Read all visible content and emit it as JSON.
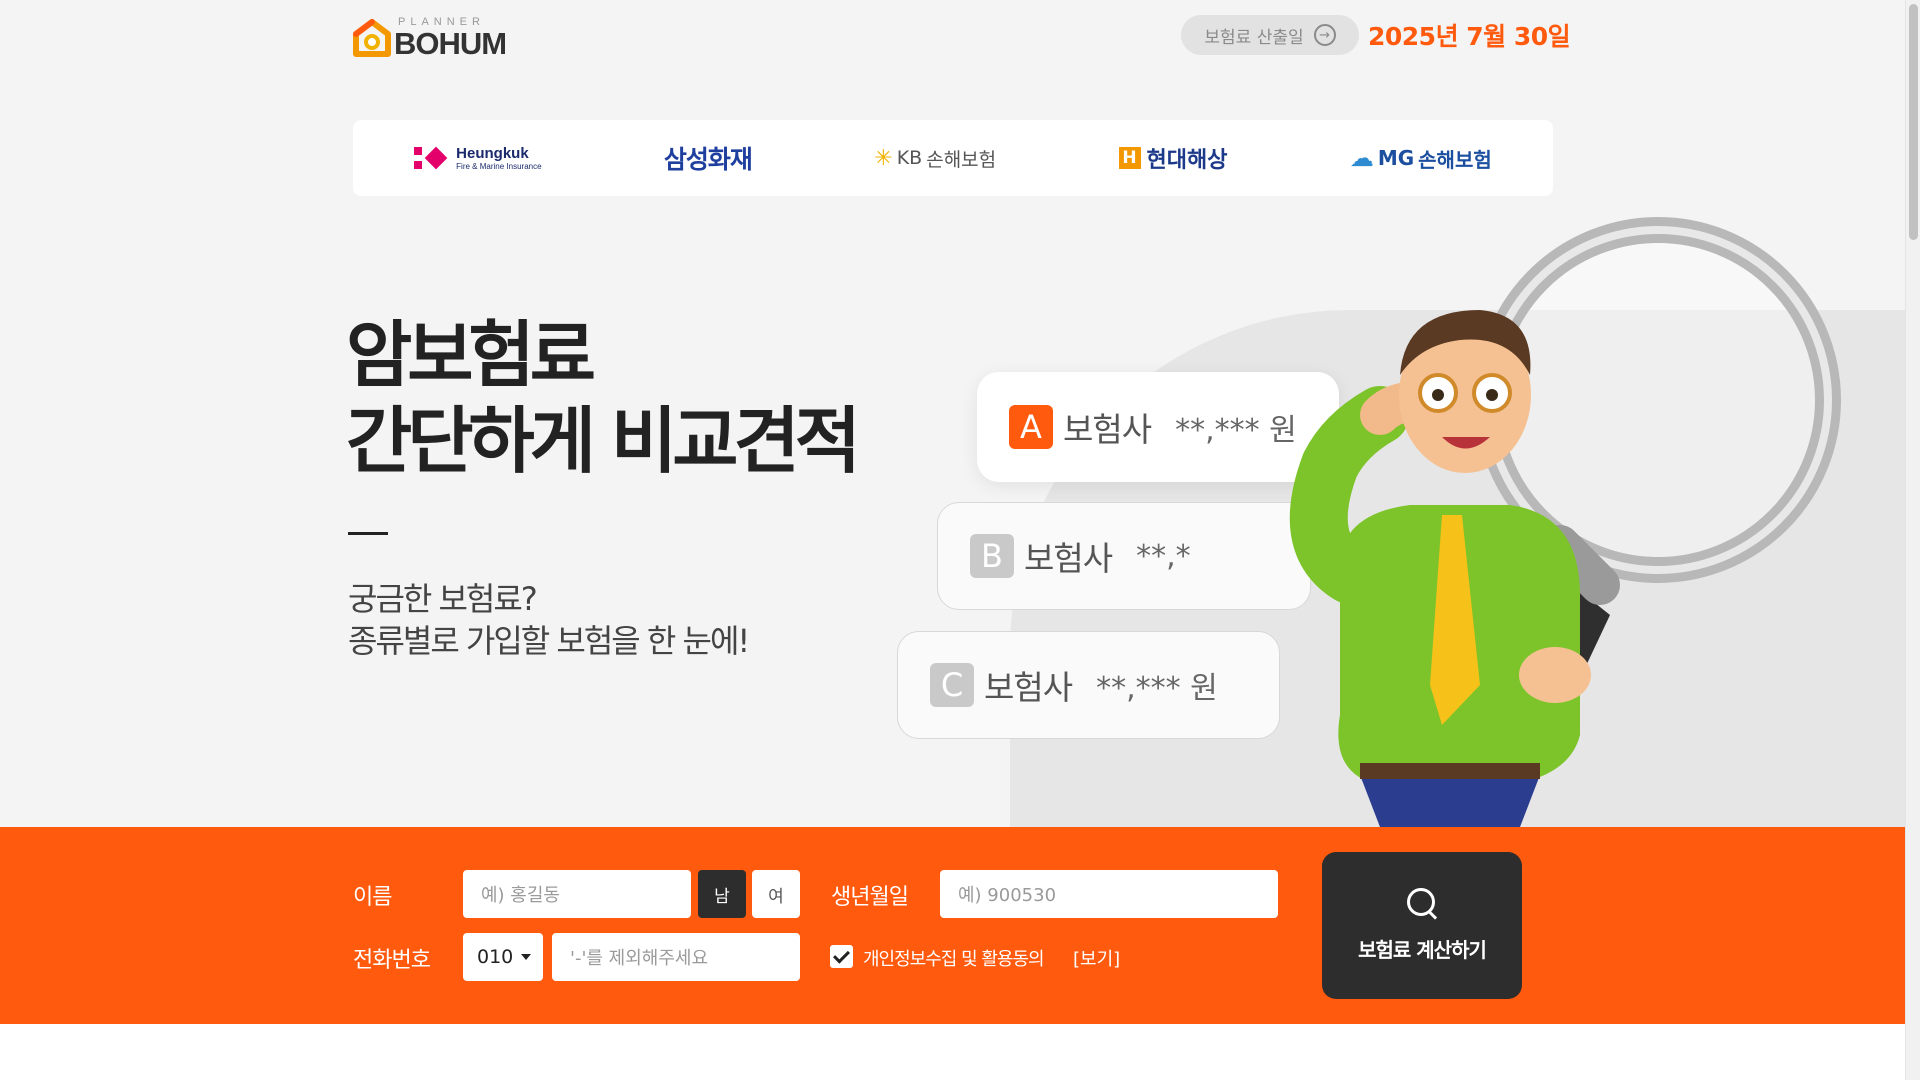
{
  "header": {
    "logo_top": "PLANNER",
    "logo_main": "BOHUM",
    "calc_date_label": "보험료 산출일",
    "calc_date_icon": "arrow-right-circle-icon",
    "date": "2025년 7월 30일"
  },
  "insurers": {
    "heungkuk_name": "Heungkuk",
    "heungkuk_sub": "Fire & Marine Insurance",
    "samsung": "삼성화재",
    "kb_prefix": "KB",
    "kb_name": "손해보험",
    "hyundai_mark": "H",
    "hyundai": "현대해상",
    "mg_prefix": "MG",
    "mg_name": "손해보험"
  },
  "hero": {
    "title_line1": "암보험료",
    "title_line2": "간단하게 비교견적",
    "sub_line1": "궁금한 보험료?",
    "sub_line2": "종류별로 가입할 보험을 한 눈에!",
    "quotes": [
      {
        "letter": "A",
        "label": "보험사",
        "amount": "**,*** 원"
      },
      {
        "letter": "B",
        "label": "보험사",
        "amount": "**,*"
      },
      {
        "letter": "C",
        "label": "보험사",
        "amount": "**,*** 원"
      }
    ]
  },
  "form": {
    "name_label": "이름",
    "name_placeholder": "예) 홍길동",
    "gender_male": "남",
    "gender_female": "여",
    "gender_selected": "남",
    "birth_label": "생년월일",
    "birth_placeholder": "예) 900530",
    "phone_label": "전화번호",
    "phone_prefix": "010",
    "phone_placeholder": "'-'를 제외해주세요",
    "consent_text": "개인정보수집 및 활용동의",
    "consent_view": "[보기]",
    "consent_checked": true,
    "submit_label": "보험료 계산하기"
  },
  "colors": {
    "accent": "#ff5a0d",
    "dark": "#2d2d2d"
  }
}
